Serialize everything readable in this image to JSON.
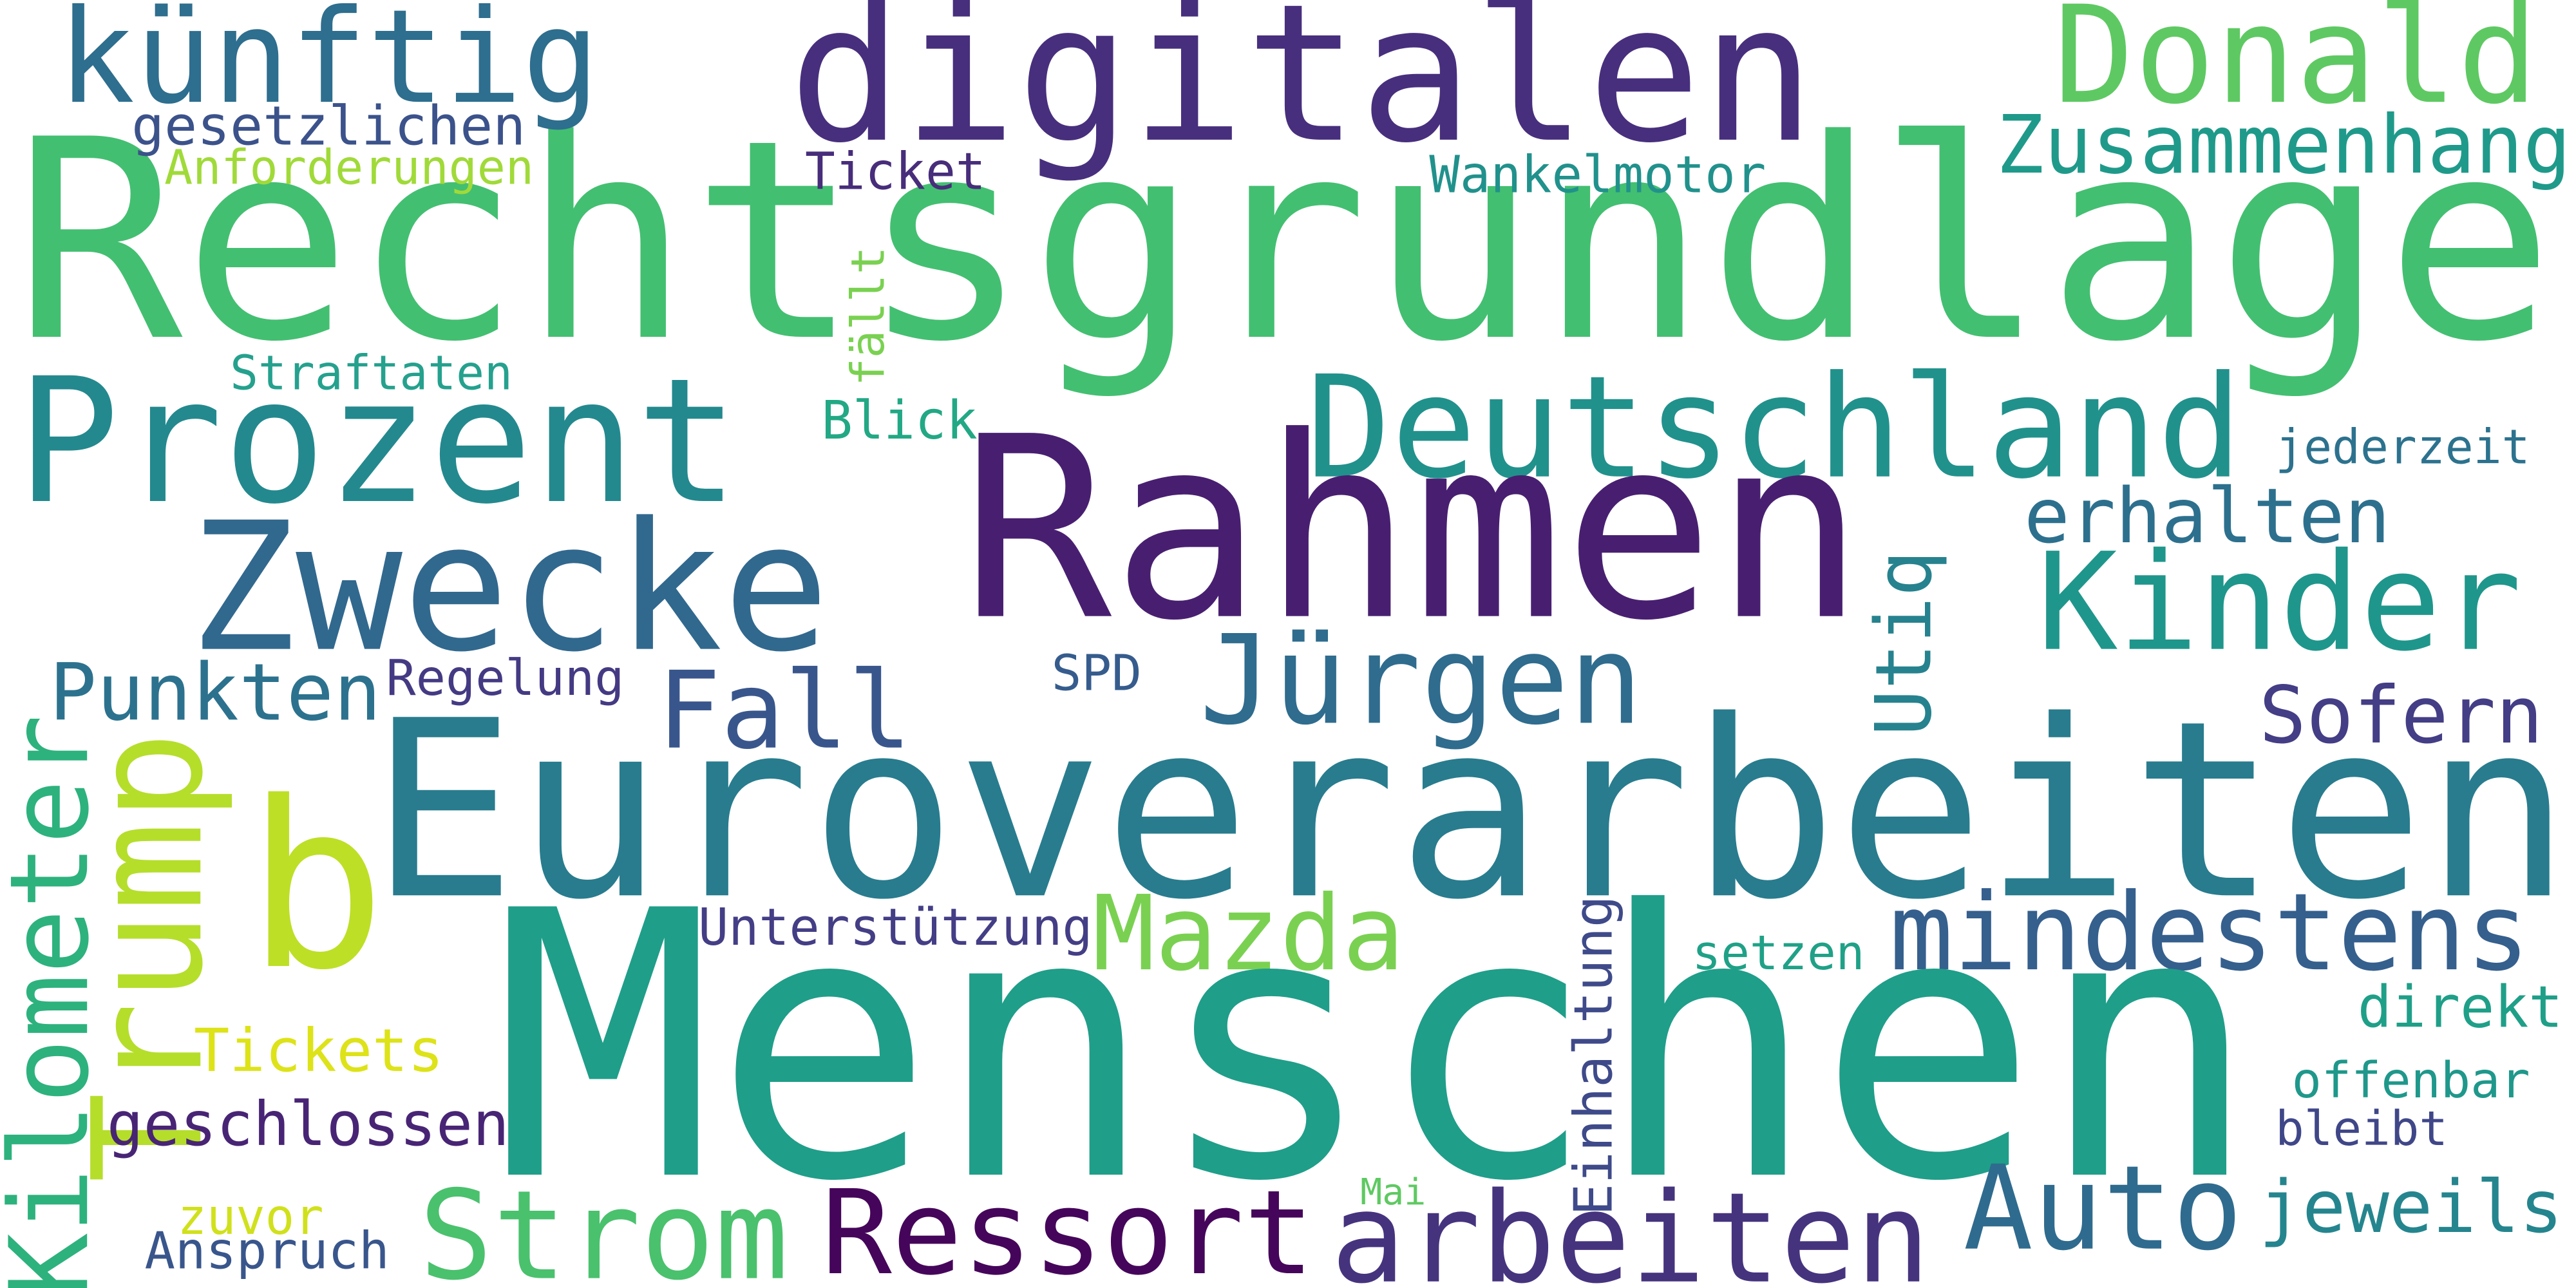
{
  "words": [
    {
      "text": "Rechtsgrundlage",
      "color": "#43bf71"
    },
    {
      "text": "digitalen",
      "color": "#472f7d"
    },
    {
      "text": "künftig",
      "color": "#2e6e8e"
    },
    {
      "text": "Donald",
      "color": "#5ec962"
    },
    {
      "text": "gesetzlichen",
      "color": "#3b528b"
    },
    {
      "text": "Anforderungen",
      "color": "#a0da39"
    },
    {
      "text": "Ticket",
      "color": "#472d7b"
    },
    {
      "text": "Wankelmotor",
      "color": "#21918c"
    },
    {
      "text": "Zusammenhang",
      "color": "#1f9a8a"
    },
    {
      "text": "fällt",
      "color": "#7ad151"
    },
    {
      "text": "Straftaten",
      "color": "#25a18e"
    },
    {
      "text": "Blick",
      "color": "#22a884"
    },
    {
      "text": "Prozent",
      "color": "#23898e"
    },
    {
      "text": "Deutschland",
      "color": "#21918c"
    },
    {
      "text": "jederzeit",
      "color": "#2c728e"
    },
    {
      "text": "Rahmen",
      "color": "#481f70"
    },
    {
      "text": "Zwecke",
      "color": "#31688e"
    },
    {
      "text": "erhalten",
      "color": "#2d708e"
    },
    {
      "text": "Kinder",
      "color": "#1f968b"
    },
    {
      "text": "Utiq",
      "color": "#26828e"
    },
    {
      "text": "Punkten",
      "color": "#2c728e"
    },
    {
      "text": "Regelung",
      "color": "#443a83"
    },
    {
      "text": "Fall",
      "color": "#39568c"
    },
    {
      "text": "Jürgen",
      "color": "#2f6c8e"
    },
    {
      "text": "SPD",
      "color": "#365c8d"
    },
    {
      "text": "Sofern",
      "color": "#433e85"
    },
    {
      "text": "Euroverarbeiten",
      "color": "#287c8e"
    },
    {
      "text": "b",
      "color": "#bddf26"
    },
    {
      "text": "Trump",
      "color": "#b5de2b"
    },
    {
      "text": "Kilometer",
      "color": "#2db27d"
    },
    {
      "text": "Mazda",
      "color": "#7ad151"
    },
    {
      "text": "mindestens",
      "color": "#355f8d"
    },
    {
      "text": "Unterstützung",
      "color": "#433e85"
    },
    {
      "text": "Einhaltung",
      "color": "#3e4a89"
    },
    {
      "text": "setzen",
      "color": "#1fa187"
    },
    {
      "text": "direkt",
      "color": "#1f9f88"
    },
    {
      "text": "Menschen",
      "color": "#1f9e89"
    },
    {
      "text": "Tickets",
      "color": "#dde318"
    },
    {
      "text": "geschlossen",
      "color": "#482475"
    },
    {
      "text": "offenbar",
      "color": "#1f988b"
    },
    {
      "text": "bleibt",
      "color": "#3f4788"
    },
    {
      "text": "Mai",
      "color": "#5ec962"
    },
    {
      "text": "zuvor",
      "color": "#d0e11c"
    },
    {
      "text": "Anspruch",
      "color": "#39568c"
    },
    {
      "text": "Strom",
      "color": "#4ac16d"
    },
    {
      "text": "Ressort",
      "color": "#45055a"
    },
    {
      "text": "arbeiten",
      "color": "#46337e"
    },
    {
      "text": "Auto",
      "color": "#2f6b8e"
    },
    {
      "text": "jeweils",
      "color": "#25858e"
    }
  ]
}
